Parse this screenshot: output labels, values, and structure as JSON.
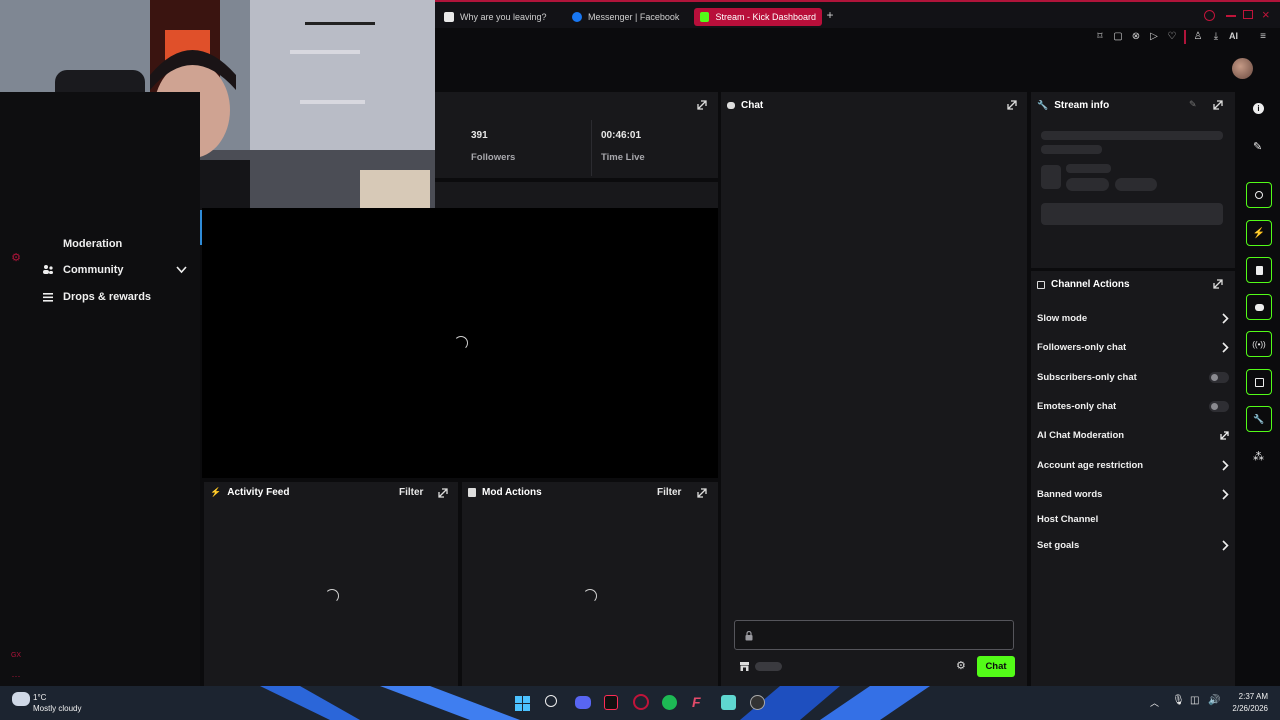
{
  "browser": {
    "tabs": [
      {
        "label": "Why are you leaving?"
      },
      {
        "label": "Messenger | Facebook"
      },
      {
        "label": "Stream - Kick Dashboard"
      }
    ],
    "toolbar_ai_label": "AI"
  },
  "sidebar": {
    "items": [
      {
        "label": "Moderation"
      },
      {
        "label": "Community"
      },
      {
        "label": "Drops & rewards"
      }
    ],
    "gx_label": "GX"
  },
  "stats": {
    "followers_value": "391",
    "followers_label": "Followers",
    "time_value": "00:46:01",
    "time_label": "Time Live"
  },
  "panels": {
    "chat_title": "Chat",
    "stream_info_title": "Stream info",
    "channel_actions_title": "Channel Actions",
    "activity_feed_title": "Activity Feed",
    "mod_actions_title": "Mod Actions",
    "filter_label": "Filter"
  },
  "channel_actions": [
    {
      "label": "Slow mode",
      "control": "chevron"
    },
    {
      "label": "Followers-only chat",
      "control": "chevron"
    },
    {
      "label": "Subscribers-only chat",
      "control": "toggle"
    },
    {
      "label": "Emotes-only chat",
      "control": "toggle"
    },
    {
      "label": "AI Chat Moderation",
      "control": "external"
    },
    {
      "label": "Account age restriction",
      "control": "chevron"
    },
    {
      "label": "Banned words",
      "control": "chevron"
    },
    {
      "label": "Host Channel",
      "control": "none"
    },
    {
      "label": "Set goals",
      "control": "chevron"
    }
  ],
  "chat": {
    "send_label": "Chat"
  },
  "taskbar": {
    "temperature": "1°C",
    "weather": "Mostly cloudy",
    "time": "2:37 AM",
    "date": "2/26/2026"
  },
  "colors": {
    "brand_green": "#53fc18",
    "browser_accent": "#b80f3a",
    "panel_bg": "#18181b"
  }
}
